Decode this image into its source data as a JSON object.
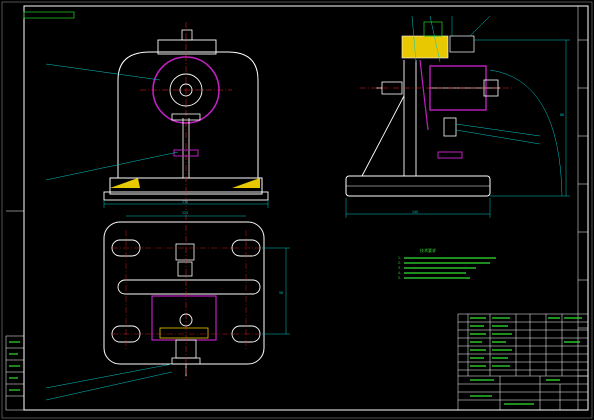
{
  "drawing": {
    "top_left_label": "",
    "colors": {
      "background": "#000000",
      "outline": "#ffffff",
      "frame": "#ffffff",
      "dimension": "#00c8c8",
      "centerline": "#ff2020",
      "magenta": "#c020c0",
      "yellow": "#e8c800",
      "green": "#20c020",
      "text_green": "#30e030"
    }
  },
  "dimensions": {
    "front_width": "170",
    "bottom_width": "125",
    "side_width": "140",
    "side_height": "88",
    "bottom_height": "56"
  },
  "notes": {
    "title": "技术要求",
    "lines": [
      "1.",
      "2.",
      "3.",
      "4.",
      "5."
    ]
  },
  "title_block": {
    "drawing_name": ""
  }
}
